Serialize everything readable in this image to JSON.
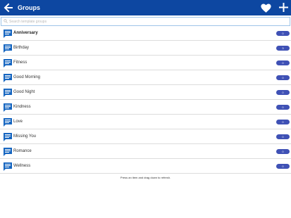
{
  "app_bar": {
    "title": "Groups",
    "background": "#0d47a1",
    "icons": [
      "back-arrow-icon",
      "heart-icon",
      "plus-icon"
    ]
  },
  "search": {
    "placeholder": "Search template groups"
  },
  "groups": [
    {
      "label": "Anniversary",
      "count": "0",
      "selected": true
    },
    {
      "label": "Birthday",
      "count": "3"
    },
    {
      "label": "Fitness",
      "count": "0"
    },
    {
      "label": "Good Morning",
      "count": "0"
    },
    {
      "label": "Good Night",
      "count": "0"
    },
    {
      "label": "Kindness",
      "count": "0"
    },
    {
      "label": "Love",
      "count": "0"
    },
    {
      "label": "Missing You",
      "count": "0"
    },
    {
      "label": "Romance",
      "count": "0"
    },
    {
      "label": "Wellness",
      "count": "0"
    }
  ],
  "row_icon": "message-icon",
  "badge_color": "#3f51b5",
  "footer": {
    "hint": "Press an item and drag down to refresh."
  }
}
